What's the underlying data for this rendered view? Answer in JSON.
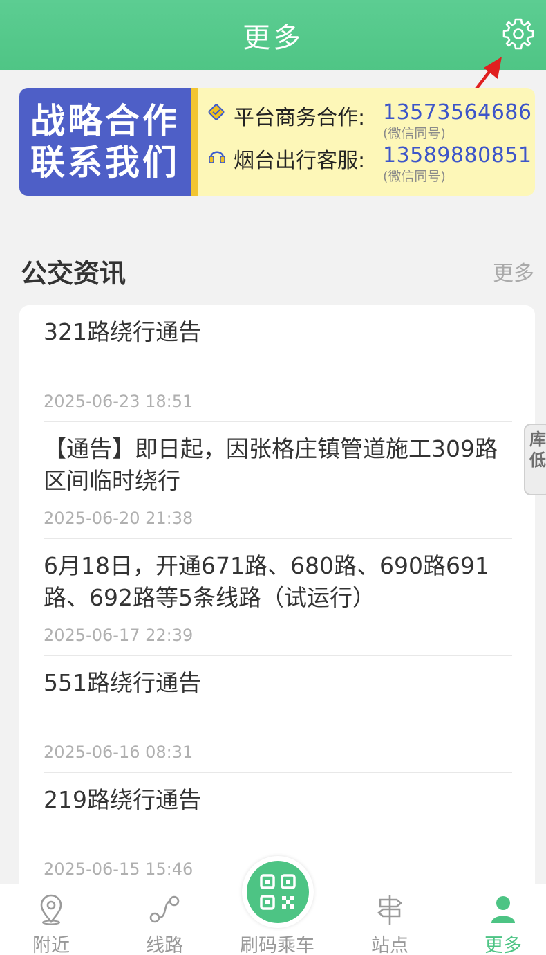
{
  "header": {
    "title": "更多"
  },
  "banner": {
    "left_line1": "战略合作",
    "left_line2": "联系我们",
    "contacts": [
      {
        "label": "平台商务合作:",
        "phone": "13573564686",
        "note": "(微信同号)"
      },
      {
        "label": "烟台出行客服:",
        "phone": "13589880851",
        "note": "(微信同号)"
      }
    ]
  },
  "news_section": {
    "title": "公交资讯",
    "more": "更多",
    "items": [
      {
        "title": "321路绕行通告",
        "date": "2025-06-23 18:51"
      },
      {
        "title": "【通告】即日起，因张格庄镇管道施工309路区间临时绕行",
        "date": "2025-06-20 21:38"
      },
      {
        "title": "6月18日，开通671路、680路、690路691路、692路等5条线路（试运行）",
        "date": "2025-06-17 22:39"
      },
      {
        "title": "551路绕行通告",
        "date": "2025-06-16 08:31"
      },
      {
        "title": "219路绕行通告",
        "date": "2025-06-15 15:46"
      }
    ]
  },
  "side_widget": {
    "line1": "库",
    "line2": "低"
  },
  "bottom_nav": {
    "items": [
      {
        "label": "附近",
        "icon": "location-pin-icon"
      },
      {
        "label": "线路",
        "icon": "route-icon"
      },
      {
        "label": "刷码乘车",
        "icon": "qr-code-icon"
      },
      {
        "label": "站点",
        "icon": "signpost-icon"
      },
      {
        "label": "更多",
        "icon": "user-icon"
      }
    ],
    "active_index": 4
  },
  "colors": {
    "brand_green": "#4dc484",
    "banner_blue": "#4e5fc7",
    "banner_yellow": "#fdf7b8",
    "phone_blue": "#3d55c9",
    "annotation_red": "#e02020"
  }
}
